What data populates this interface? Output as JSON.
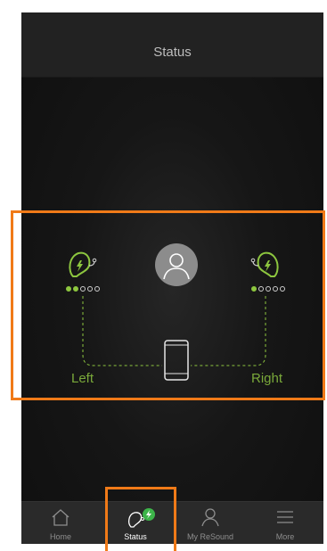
{
  "header": {
    "title": "Status"
  },
  "devices": {
    "left": {
      "label": "Left",
      "battery_level": 2,
      "battery_max": 5
    },
    "right": {
      "label": "Right",
      "battery_level": 1,
      "battery_max": 5
    }
  },
  "tabs": [
    {
      "label": "Home",
      "icon": "home-icon",
      "active": false
    },
    {
      "label": "Status",
      "icon": "hearing-aid-status-icon",
      "active": true
    },
    {
      "label": "My ReSound",
      "icon": "person-icon",
      "active": false
    },
    {
      "label": "More",
      "icon": "menu-icon",
      "active": false
    }
  ],
  "colors": {
    "accent_green": "#8dc63f",
    "label_green": "#7aa93a",
    "highlight_orange": "#f07a18",
    "background": "#161616"
  }
}
